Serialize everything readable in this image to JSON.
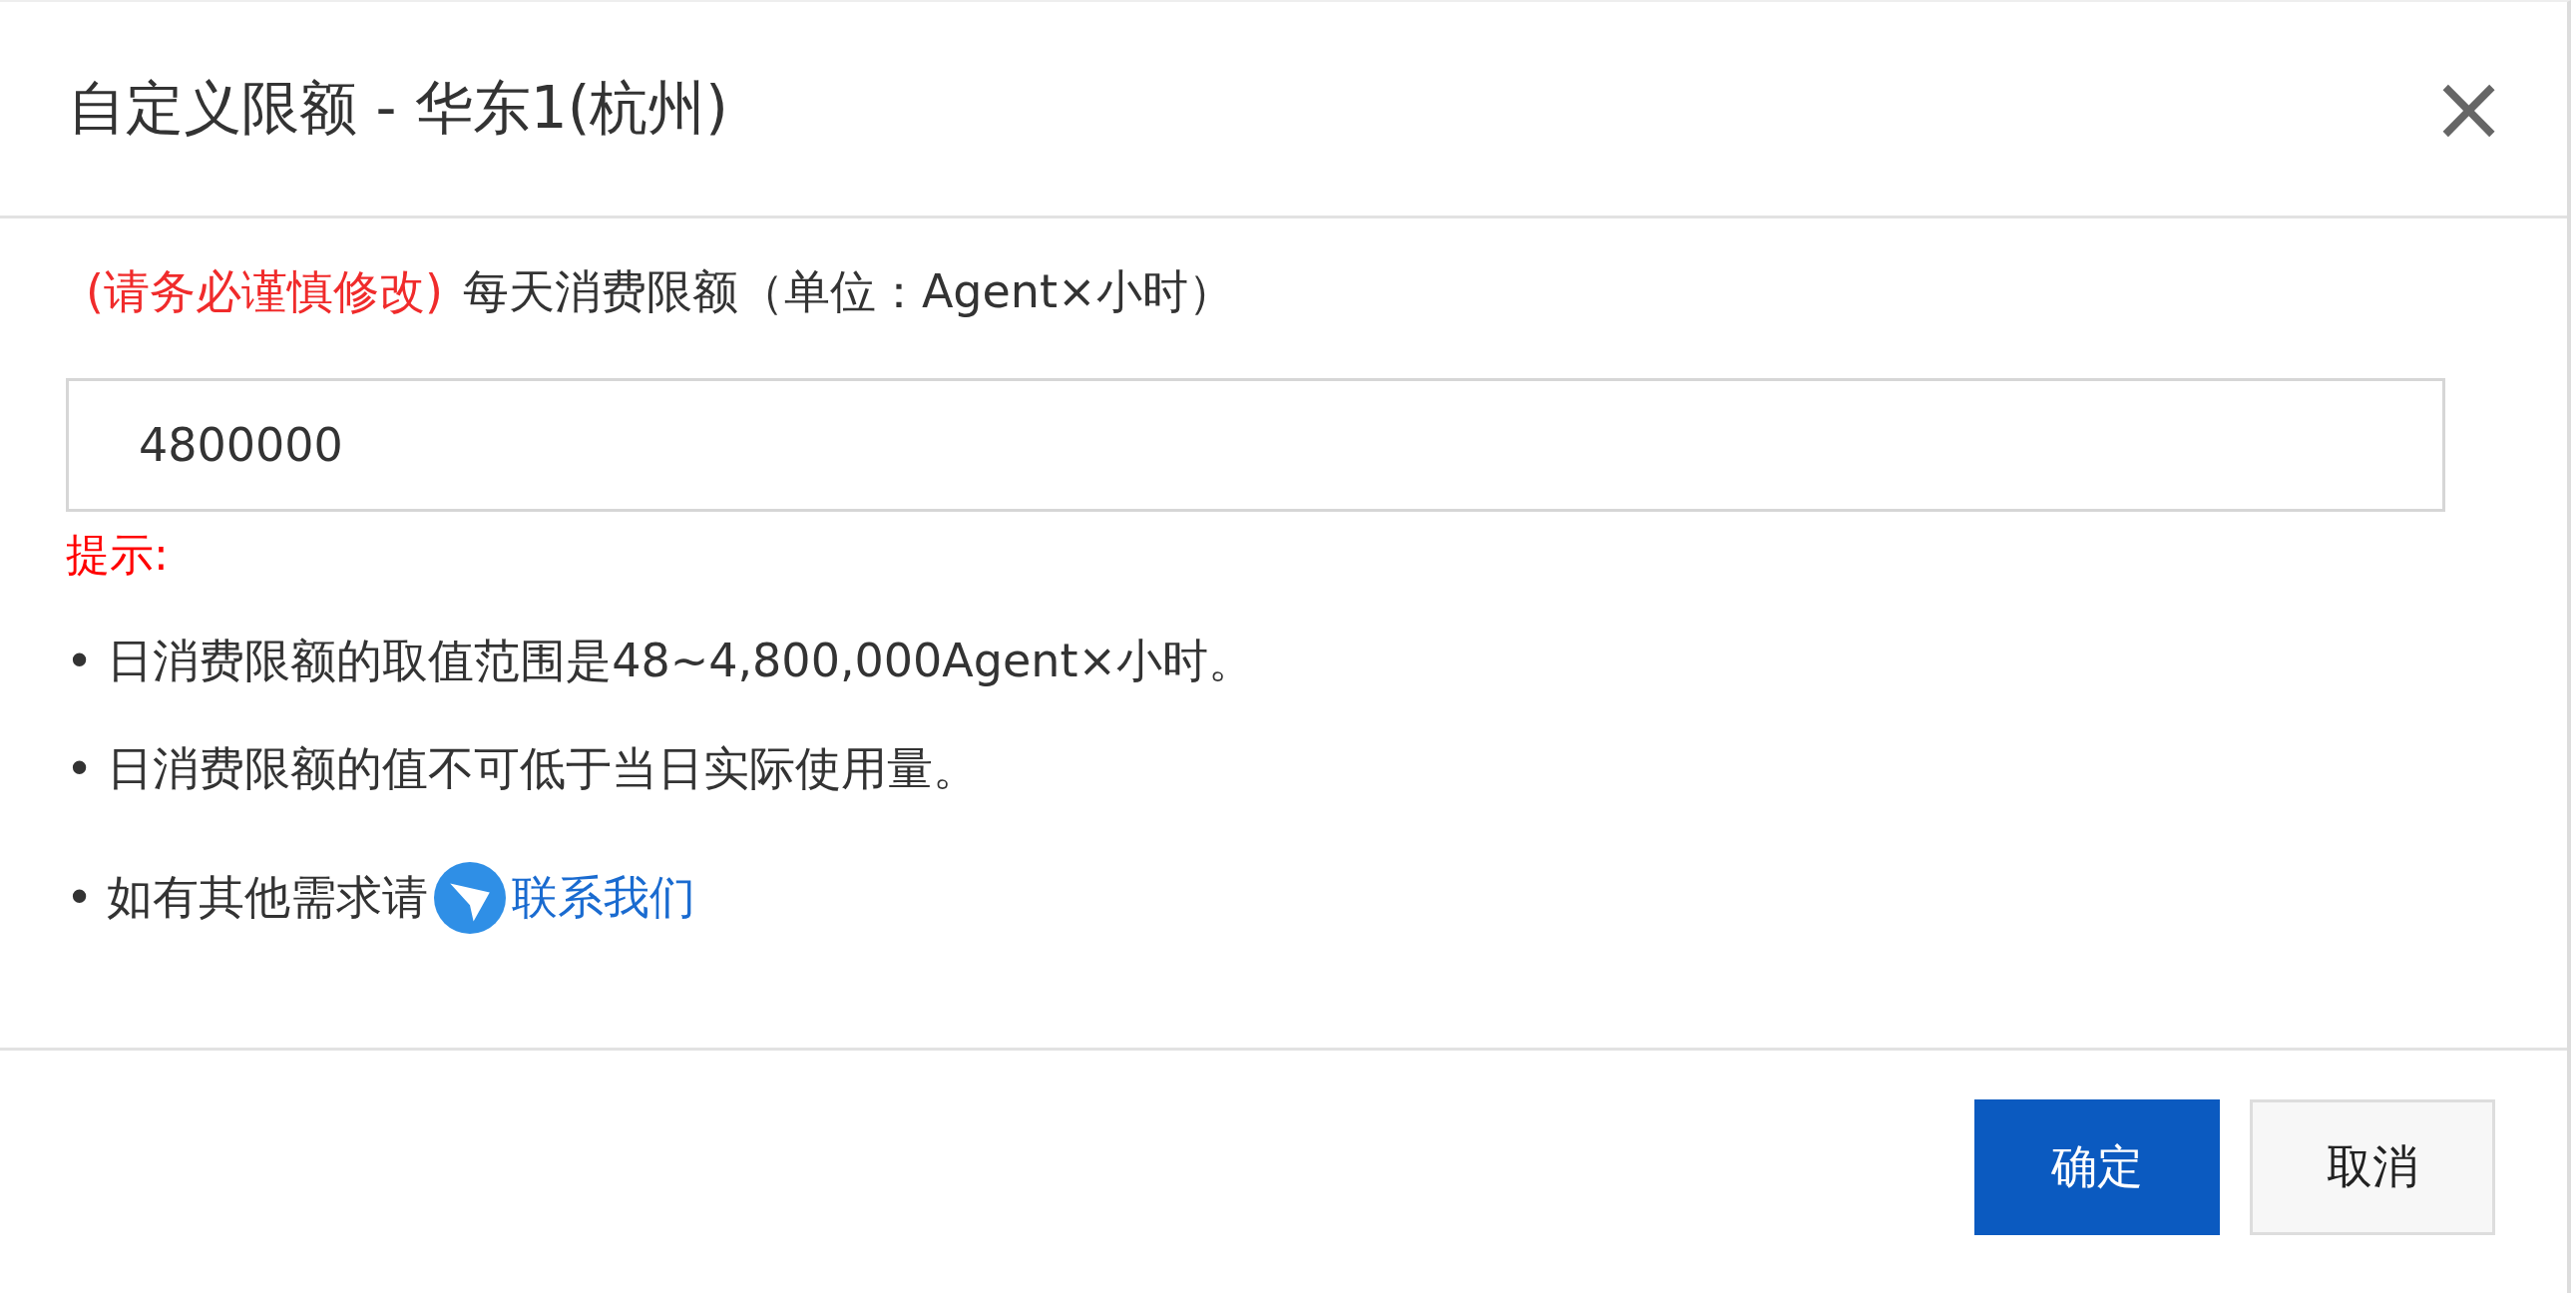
{
  "dialog": {
    "title": "自定义限额 - 华东1(杭州)",
    "close": "×"
  },
  "field": {
    "warning": "(请务必谨慎修改)",
    "label": "每天消费限额（单位：Agent×小时）",
    "value": "4800000"
  },
  "hint": {
    "title": "提示:",
    "items": [
      {
        "bullet": "•",
        "text": "日消费限额的取值范围是48~4,800,000Agent×小时。"
      },
      {
        "bullet": "•",
        "text": "日消费限额的值不可低于当日实际使用量。"
      },
      {
        "bullet": "•",
        "text": "如有其他需求请",
        "link": "联系我们"
      }
    ]
  },
  "buttons": [
    {
      "label": "确定",
      "kind": "primary"
    },
    {
      "label": "取消",
      "kind": "default"
    }
  ]
}
